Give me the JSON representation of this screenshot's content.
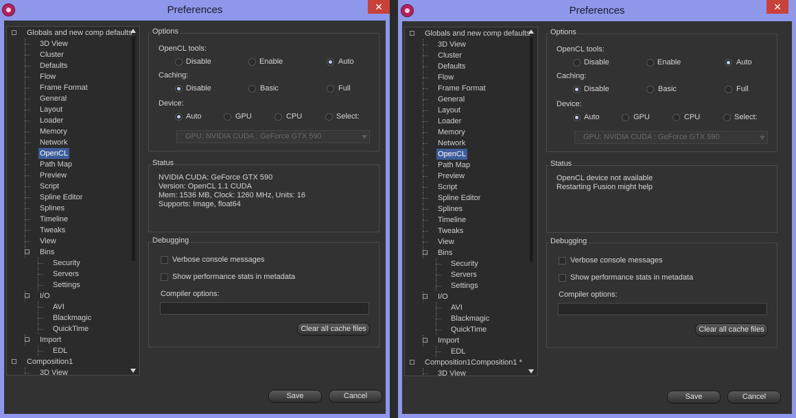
{
  "window_title": "Preferences",
  "close_glyph": "✕",
  "tree_items": [
    {
      "label": "Globals and new comp defaults",
      "level": 0,
      "expander": true
    },
    {
      "label": "3D View",
      "level": 1
    },
    {
      "label": "Cluster",
      "level": 1
    },
    {
      "label": "Defaults",
      "level": 1
    },
    {
      "label": "Flow",
      "level": 1
    },
    {
      "label": "Frame Format",
      "level": 1
    },
    {
      "label": "General",
      "level": 1
    },
    {
      "label": "Layout",
      "level": 1
    },
    {
      "label": "Loader",
      "level": 1
    },
    {
      "label": "Memory",
      "level": 1
    },
    {
      "label": "Network",
      "level": 1
    },
    {
      "label": "OpenCL",
      "level": 1,
      "selected": true
    },
    {
      "label": "Path Map",
      "level": 1
    },
    {
      "label": "Preview",
      "level": 1
    },
    {
      "label": "Script",
      "level": 1
    },
    {
      "label": "Spline Editor",
      "level": 1
    },
    {
      "label": "Splines",
      "level": 1
    },
    {
      "label": "Timeline",
      "level": 1
    },
    {
      "label": "Tweaks",
      "level": 1
    },
    {
      "label": "View",
      "level": 1
    },
    {
      "label": "Bins",
      "level": 1,
      "expander": true
    },
    {
      "label": "Security",
      "level": 2
    },
    {
      "label": "Servers",
      "level": 2
    },
    {
      "label": "Settings",
      "level": 2
    },
    {
      "label": "I/O",
      "level": 1,
      "expander": true
    },
    {
      "label": "AVI",
      "level": 2
    },
    {
      "label": "Blackmagic",
      "level": 2
    },
    {
      "label": "QuickTime",
      "level": 2
    },
    {
      "label": "Import",
      "level": 1,
      "expander": true
    },
    {
      "label": "EDL",
      "level": 2
    },
    {
      "label": "Composition1",
      "level": 0,
      "expander": true
    },
    {
      "label": "3D View",
      "level": 1
    }
  ],
  "options": {
    "title": "Options",
    "opencl_tools_label": "OpenCL tools:",
    "opencl_tools": [
      "Disable",
      "Enable",
      "Auto"
    ],
    "caching_label": "Caching:",
    "caching": [
      "Disable",
      "Basic",
      "Full"
    ],
    "device_label": "Device:",
    "device": [
      "Auto",
      "GPU",
      "CPU",
      "Select:"
    ],
    "gpu_select": "GPU: NVIDIA CUDA : GeForce GTX 590"
  },
  "status_title": "Status",
  "debugging": {
    "title": "Debugging",
    "verbose": "Verbose console messages",
    "perf_stats": "Show performance stats in metadata",
    "compiler_label": "Compiler options:",
    "compiler_value": "",
    "clear_cache": "Clear all cache files"
  },
  "buttons": {
    "save": "Save",
    "cancel": "Cancel"
  },
  "windows": [
    {
      "opencl_tools_selected": "Auto",
      "caching_selected": "Disable",
      "device_selected": "Auto",
      "status_lines": [
        "NVIDIA CUDA: GeForce GTX 590",
        "Version: OpenCL 1.1 CUDA",
        "Mem: 1536 MB, Clock: 1260 MHz, Units: 16",
        "Supports: Image, float64"
      ],
      "tree_last_suffix": ""
    },
    {
      "opencl_tools_selected": "Auto",
      "caching_selected": "Disable",
      "device_selected": "Auto",
      "status_lines": [
        "OpenCL device not available",
        "Restarting Fusion might help"
      ],
      "tree_last_suffix": " *"
    }
  ],
  "colors": {
    "titlebar": "#8e97ea",
    "close": "#c8413a",
    "panel": "#323232",
    "selection": "#3e5c9a"
  }
}
